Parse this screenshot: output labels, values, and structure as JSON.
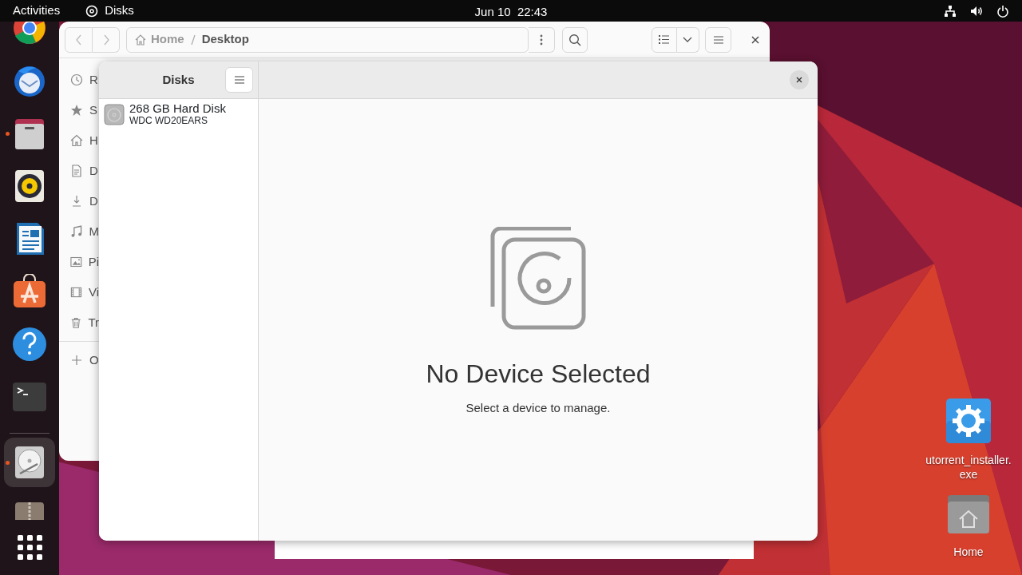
{
  "top_bar": {
    "activities": "Activities",
    "app_name": "Disks",
    "clock": "Jun 10  22:43"
  },
  "dock": {
    "items": [
      {
        "kind": "browser",
        "running": false,
        "selected": false
      },
      {
        "kind": "mail",
        "running": false,
        "selected": false
      },
      {
        "kind": "files",
        "running": true,
        "selected": false
      },
      {
        "kind": "music",
        "running": false,
        "selected": false
      },
      {
        "kind": "writer",
        "running": false,
        "selected": false
      },
      {
        "kind": "store",
        "running": false,
        "selected": false
      },
      {
        "kind": "help",
        "running": false,
        "selected": false
      },
      {
        "kind": "terminal",
        "running": false,
        "selected": false
      },
      {
        "kind": "disks",
        "running": true,
        "selected": true
      },
      {
        "kind": "archive",
        "running": false,
        "selected": false
      }
    ]
  },
  "files_window": {
    "path": [
      "Home",
      "Desktop"
    ],
    "sidebar": [
      {
        "kind": "recent",
        "label": "R"
      },
      {
        "kind": "starred",
        "label": "S"
      },
      {
        "kind": "home",
        "label": "H"
      },
      {
        "kind": "documents",
        "label": "D"
      },
      {
        "kind": "downloads",
        "label": "D"
      },
      {
        "kind": "music",
        "label": "M"
      },
      {
        "kind": "pictures",
        "label": "Pi"
      },
      {
        "kind": "videos",
        "label": "Vi"
      },
      {
        "kind": "trash",
        "label": "Tr"
      },
      {
        "kind": "other",
        "label": "O"
      }
    ]
  },
  "disks_window": {
    "title": "Disks",
    "devices": [
      {
        "name": "268 GB Hard Disk",
        "model": "WDC WD20EARS",
        "selected": false
      }
    ],
    "empty_title": "No Device Selected",
    "empty_subtitle": "Select a device to manage."
  },
  "desktop_icons": [
    {
      "kind": "installer",
      "label_lines": [
        "utorrent_installer.",
        "exe"
      ]
    },
    {
      "kind": "home",
      "label_lines": [
        "Home"
      ]
    }
  ]
}
